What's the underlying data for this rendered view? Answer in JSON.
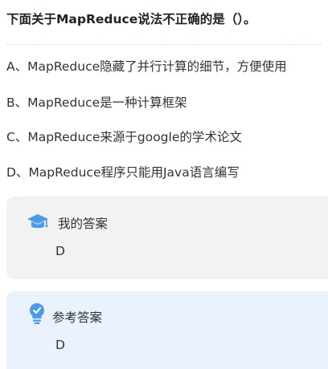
{
  "question": {
    "title": "下面关于MapReduce说法不正确的是（）。"
  },
  "options": [
    {
      "letter": "A、",
      "text": "MapReduce隐藏了并行计算的细节，方便使用"
    },
    {
      "letter": "B、",
      "text": "MapReduce是一种计算框架"
    },
    {
      "letter": "C、",
      "text": "MapReduce来源于google的学术论文"
    },
    {
      "letter": "D、",
      "text": "MapReduce程序只能用Java语言编写"
    }
  ],
  "my_answer": {
    "label": "我的答案",
    "value": "D",
    "icon": "graduation-cap-icon"
  },
  "reference_answer": {
    "label": "参考答案",
    "value": "D",
    "icon": "lightbulb-icon"
  },
  "colors": {
    "accent_blue": "#4a9be8",
    "my_answer_bg": "#f2f2f2",
    "reference_bg": "#e9f2fd"
  }
}
